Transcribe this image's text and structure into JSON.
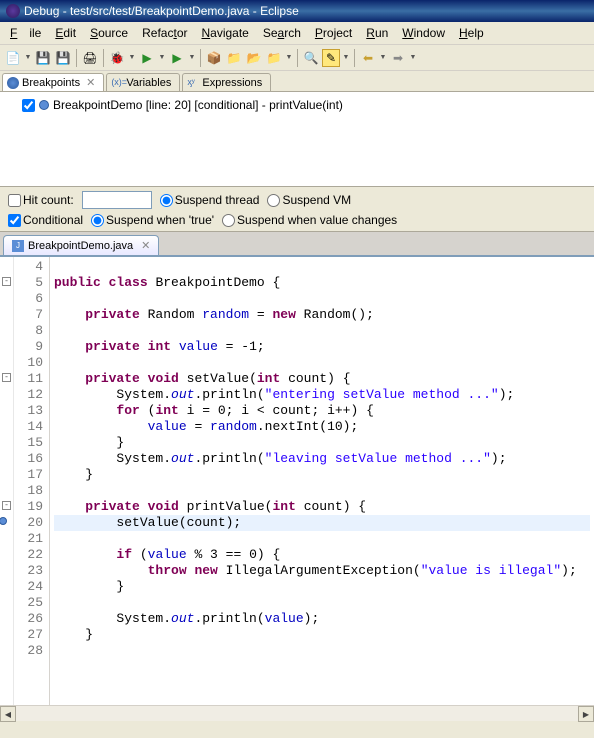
{
  "title": "Debug - test/src/test/BreakpointDemo.java - Eclipse",
  "menu": {
    "file": "File",
    "edit": "Edit",
    "source": "Source",
    "refactor": "Refactor",
    "navigate": "Navigate",
    "search": "Search",
    "project": "Project",
    "run": "Run",
    "window": "Window",
    "help": "Help"
  },
  "views": {
    "breakpoints": "Breakpoints",
    "variables": "Variables",
    "expressions": "Expressions"
  },
  "breakpoint_item": "BreakpointDemo [line: 20] [conditional] - printValue(int)",
  "options": {
    "hit_count_label": "Hit count:",
    "hit_count_value": "",
    "suspend_thread": "Suspend thread",
    "suspend_vm": "Suspend VM",
    "conditional": "Conditional",
    "suspend_true": "Suspend when 'true'",
    "suspend_changes": "Suspend when value changes"
  },
  "editor_tab": "BreakpointDemo.java",
  "code_lines": [
    {
      "n": 4,
      "html": ""
    },
    {
      "n": 5,
      "html": "<span class='kw'>public</span> <span class='kw'>class</span> BreakpointDemo {",
      "marker": "minus"
    },
    {
      "n": 6,
      "html": ""
    },
    {
      "n": 7,
      "html": "    <span class='kw'>private</span> Random <span class='fld'>random</span> = <span class='kw'>new</span> Random();"
    },
    {
      "n": 8,
      "html": ""
    },
    {
      "n": 9,
      "html": "    <span class='kw'>private</span> <span class='kw'>int</span> <span class='fld'>value</span> = -1;"
    },
    {
      "n": 10,
      "html": ""
    },
    {
      "n": 11,
      "html": "    <span class='kw'>private</span> <span class='kw'>void</span> setValue(<span class='kw'>int</span> count) {",
      "marker": "minus"
    },
    {
      "n": 12,
      "html": "        System.<span class='stat'>out</span>.println(<span class='str'>\"entering setValue method ...\"</span>);"
    },
    {
      "n": 13,
      "html": "        <span class='kw'>for</span> (<span class='kw'>int</span> i = 0; i &lt; count; i++) {"
    },
    {
      "n": 14,
      "html": "            <span class='fld'>value</span> = <span class='fld'>random</span>.nextInt(10);"
    },
    {
      "n": 15,
      "html": "        }"
    },
    {
      "n": 16,
      "html": "        System.<span class='stat'>out</span>.println(<span class='str'>\"leaving setValue method ...\"</span>);"
    },
    {
      "n": 17,
      "html": "    }"
    },
    {
      "n": 18,
      "html": ""
    },
    {
      "n": 19,
      "html": "    <span class='kw'>private</span> <span class='kw'>void</span> printValue(<span class='kw'>int</span> count) {",
      "marker": "minus"
    },
    {
      "n": 20,
      "html": "        setValue(count);",
      "highlight": true,
      "marker": "bp"
    },
    {
      "n": 21,
      "html": ""
    },
    {
      "n": 22,
      "html": "        <span class='kw'>if</span> (<span class='fld'>value</span> % 3 == 0) {"
    },
    {
      "n": 23,
      "html": "            <span class='kw'>throw</span> <span class='kw'>new</span> IllegalArgumentException(<span class='str'>\"value is illegal\"</span>);"
    },
    {
      "n": 24,
      "html": "        }"
    },
    {
      "n": 25,
      "html": ""
    },
    {
      "n": 26,
      "html": "        System.<span class='stat'>out</span>.println(<span class='fld'>value</span>);"
    },
    {
      "n": 27,
      "html": "    }"
    },
    {
      "n": 28,
      "html": ""
    }
  ]
}
